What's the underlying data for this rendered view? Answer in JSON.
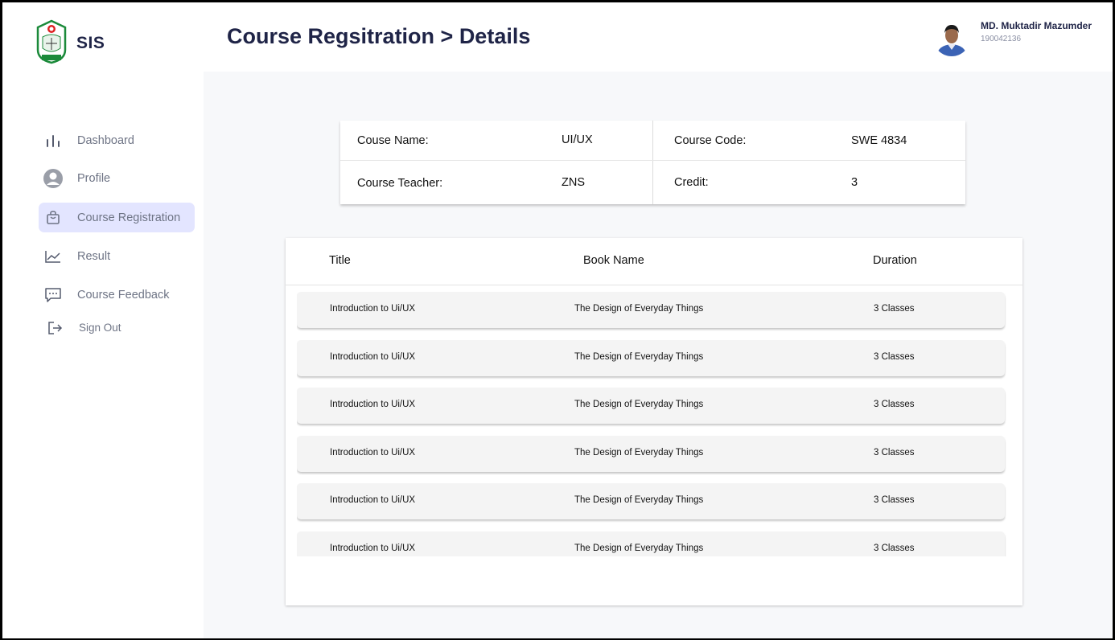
{
  "app": {
    "brand": "SIS"
  },
  "header": {
    "title": "Course Regsitration > Details"
  },
  "user": {
    "name": "MD. Muktadir Mazumder",
    "id": "190042136"
  },
  "sidebar": {
    "items": [
      {
        "label": "Dashboard",
        "icon": "bar-chart-icon",
        "active": false
      },
      {
        "label": "Profile",
        "icon": "user-circle-icon",
        "active": false
      },
      {
        "label": "Course Registration",
        "icon": "shopping-bag-icon",
        "active": true
      },
      {
        "label": "Result",
        "icon": "line-chart-icon",
        "active": false
      },
      {
        "label": "Course Feedback",
        "icon": "message-icon",
        "active": false
      },
      {
        "label": "Sign Out",
        "icon": "sign-out-icon",
        "active": false
      }
    ]
  },
  "course_info": {
    "name_label": "Couse Name:",
    "name_value": "UI/UX",
    "code_label": "Course Code:",
    "code_value": "SWE 4834",
    "teacher_label": "Course Teacher:",
    "teacher_value": "ZNS",
    "credit_label": "Credit:",
    "credit_value": "3"
  },
  "table": {
    "headers": [
      "Title",
      "Book Name",
      "Duration"
    ],
    "rows": [
      [
        "Introduction to Ui/UX",
        "The Design of Everyday Things",
        "3 Classes"
      ],
      [
        "Introduction to Ui/UX",
        "The Design of Everyday Things",
        "3 Classes"
      ],
      [
        "Introduction to Ui/UX",
        "The Design of Everyday Things",
        "3 Classes"
      ],
      [
        "Introduction to Ui/UX",
        "The Design of Everyday Things",
        "3 Classes"
      ],
      [
        "Introduction to Ui/UX",
        "The Design of Everyday Things",
        "3 Classes"
      ],
      [
        "Introduction to Ui/UX",
        "The Design of Everyday Things",
        "3 Classes"
      ]
    ]
  },
  "colors": {
    "accent": "#e3e5ff",
    "title": "#1f2447",
    "muted": "#6e7485"
  }
}
